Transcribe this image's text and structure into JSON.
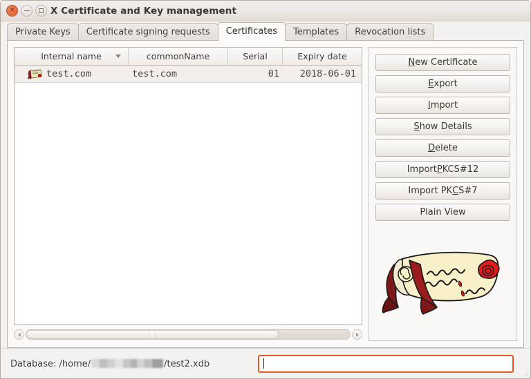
{
  "window": {
    "title": "X Certificate and Key management",
    "controls": {
      "close": "close-button",
      "minimize": "minimize-button",
      "maximize": "maximize-button"
    }
  },
  "tabs": [
    {
      "label": "Private Keys",
      "active": false
    },
    {
      "label": "Certificate signing requests",
      "active": false
    },
    {
      "label": "Certificates",
      "active": true
    },
    {
      "label": "Templates",
      "active": false
    },
    {
      "label": "Revocation lists",
      "active": false
    }
  ],
  "table": {
    "columns": [
      {
        "label": "Internal name",
        "sorted": true,
        "sort_direction": "descending"
      },
      {
        "label": "commonName",
        "sorted": false
      },
      {
        "label": "Serial",
        "sorted": false
      },
      {
        "label": "Expiry date",
        "sorted": false
      }
    ],
    "rows": [
      {
        "icon": "certificate-icon",
        "internal_name": "test.com",
        "common_name": "test.com",
        "serial": "01",
        "expiry_date": "2018-06-01",
        "selected": true
      }
    ]
  },
  "scrollbar": {
    "left_arrow": "scroll-left-icon",
    "right_arrow": "scroll-right-icon",
    "grip": "⋮⋮",
    "thumb_fraction": 78
  },
  "buttons": [
    {
      "label": "New Certificate",
      "mnemonic": "N"
    },
    {
      "label": "Export",
      "mnemonic": "E"
    },
    {
      "label": "Import",
      "mnemonic": "I"
    },
    {
      "label": "Show Details",
      "mnemonic": "S"
    },
    {
      "label": "Delete",
      "mnemonic": "D"
    },
    {
      "label": "Import PKCS#12",
      "mnemonic": "P"
    },
    {
      "label": "Import PKCS#7",
      "mnemonic": "C"
    },
    {
      "label": "Plain View",
      "mnemonic": ""
    }
  ],
  "artwork": {
    "name": "certificate-scroll-illustration",
    "scroll_color": "#f5efc8",
    "ribbon_color": "#8a1b1b",
    "seal_color": "#d81f1f"
  },
  "statusbar": {
    "database_prefix": "Database: /home/",
    "database_suffix": "/test2.xdb",
    "database_user_redacted": true,
    "input_value": "",
    "input_placeholder": "",
    "input_focused": true,
    "focus_color": "#e05a20"
  }
}
